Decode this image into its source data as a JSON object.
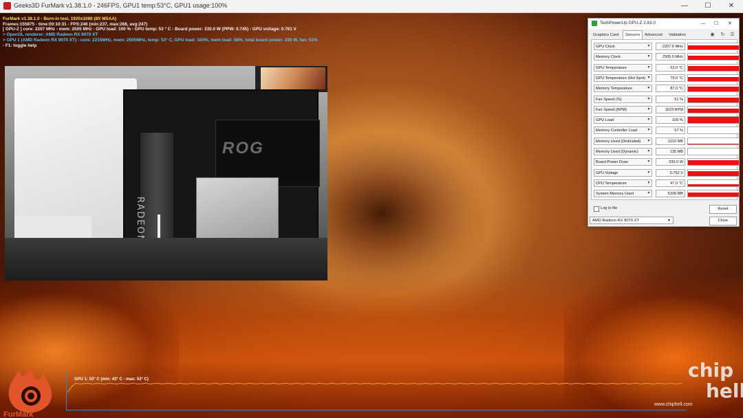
{
  "window": {
    "title": "Geeks3D FurMark v1.38.1.0 - 246FPS, GPU1 temp:53°C, GPU1 usage:100%",
    "controls": [
      "—",
      "☐",
      "✕"
    ]
  },
  "overlay": {
    "line1": "FurMark v1.38.1.0 - Burn-in test, 1920x1080 (8X MSAA)",
    "line2": "Frames:155875 - time:00:10:31 - FPS:246 (min:237, max:268, avg:247)",
    "line3": "[ GPU-Z ] core: 2207 MHz - mem: 2505 MHz - GPU load: 100 % - GPU temp: 53 ° C - Board power: 330.0 W (PPW: 0.745) - GPU voltage: 0.761 V",
    "line4": "> OpenGL renderer: AMD Radeon RX 9070 XT",
    "line5": "> GPU 1 (AMD Radeon RX 9070 XT) - core: 2215MHz, mem: 2505MHz, temp: 53° C, GPU load: 100%, mem load: 58%, total board power: 330 W, fan: 51%",
    "line6": "- F1: toggle help"
  },
  "photo": {
    "gpu_text": "RADEON",
    "board_text": "ROG"
  },
  "gpuz": {
    "title": "TechPowerUp GPU-Z 2.63.0",
    "controls": [
      "—",
      "☐",
      "✕"
    ],
    "tabs": [
      "Graphics Card",
      "Sensors",
      "Advanced",
      "Validation"
    ],
    "active_tab": "Sensors",
    "toolbar_icons": [
      "camera-icon",
      "refresh-icon",
      "menu-icon"
    ],
    "sensors": [
      {
        "name": "GPU Clock",
        "value": "2207.6 MHz",
        "level": 0.7
      },
      {
        "name": "Memory Clock",
        "value": "2505.0 MHz",
        "level": 0.7
      },
      {
        "name": "GPU Temperature",
        "value": "53.0 °C",
        "level": 0.7
      },
      {
        "name": "GPU Temperature (Hot Spot)",
        "value": "79.0 °C",
        "level": 0.7
      },
      {
        "name": "Memory Temperature",
        "value": "87.0 °C",
        "level": 0.75
      },
      {
        "name": "Fan Speed (%)",
        "value": "51 %",
        "level": 0.7
      },
      {
        "name": "Fan Speed (RPM)",
        "value": "1623 RPM",
        "level": 0.7
      },
      {
        "name": "GPU Load",
        "value": "100 %",
        "level": 1.0
      },
      {
        "name": "Memory Controller Load",
        "value": "57 %",
        "level": 0.0
      },
      {
        "name": "Memory Used (Dedicated)",
        "value": "1210 MB",
        "level": 0.1
      },
      {
        "name": "Memory Used (Dynamic)",
        "value": "135 MB",
        "level": 0.0
      },
      {
        "name": "Board Power Draw",
        "value": "330.0 W",
        "level": 0.8
      },
      {
        "name": "GPU Voltage",
        "value": "0.762 V",
        "level": 0.75
      },
      {
        "name": "CPU Temperature",
        "value": "47.0 °C",
        "level": 0.3
      },
      {
        "name": "System Memory Used",
        "value": "5339 MB",
        "level": 0.7
      }
    ],
    "log_label": "Log to file",
    "reset_label": "Reset",
    "close_label": "Close",
    "device_select": "AMD Radeon RX 9070 XT",
    "sensor_color": "#ee1111"
  },
  "temp_graph": {
    "label": "GPU 1: 53° C (min: 43° C - max: 53° C)",
    "line_color": "#f0a020",
    "axis_color": "#3a86c4"
  },
  "logos": {
    "furmark": "FurMark",
    "chiphell_top": "chip",
    "chiphell_bottom": "hell",
    "chiphell_url": "www.chiphell.com"
  }
}
